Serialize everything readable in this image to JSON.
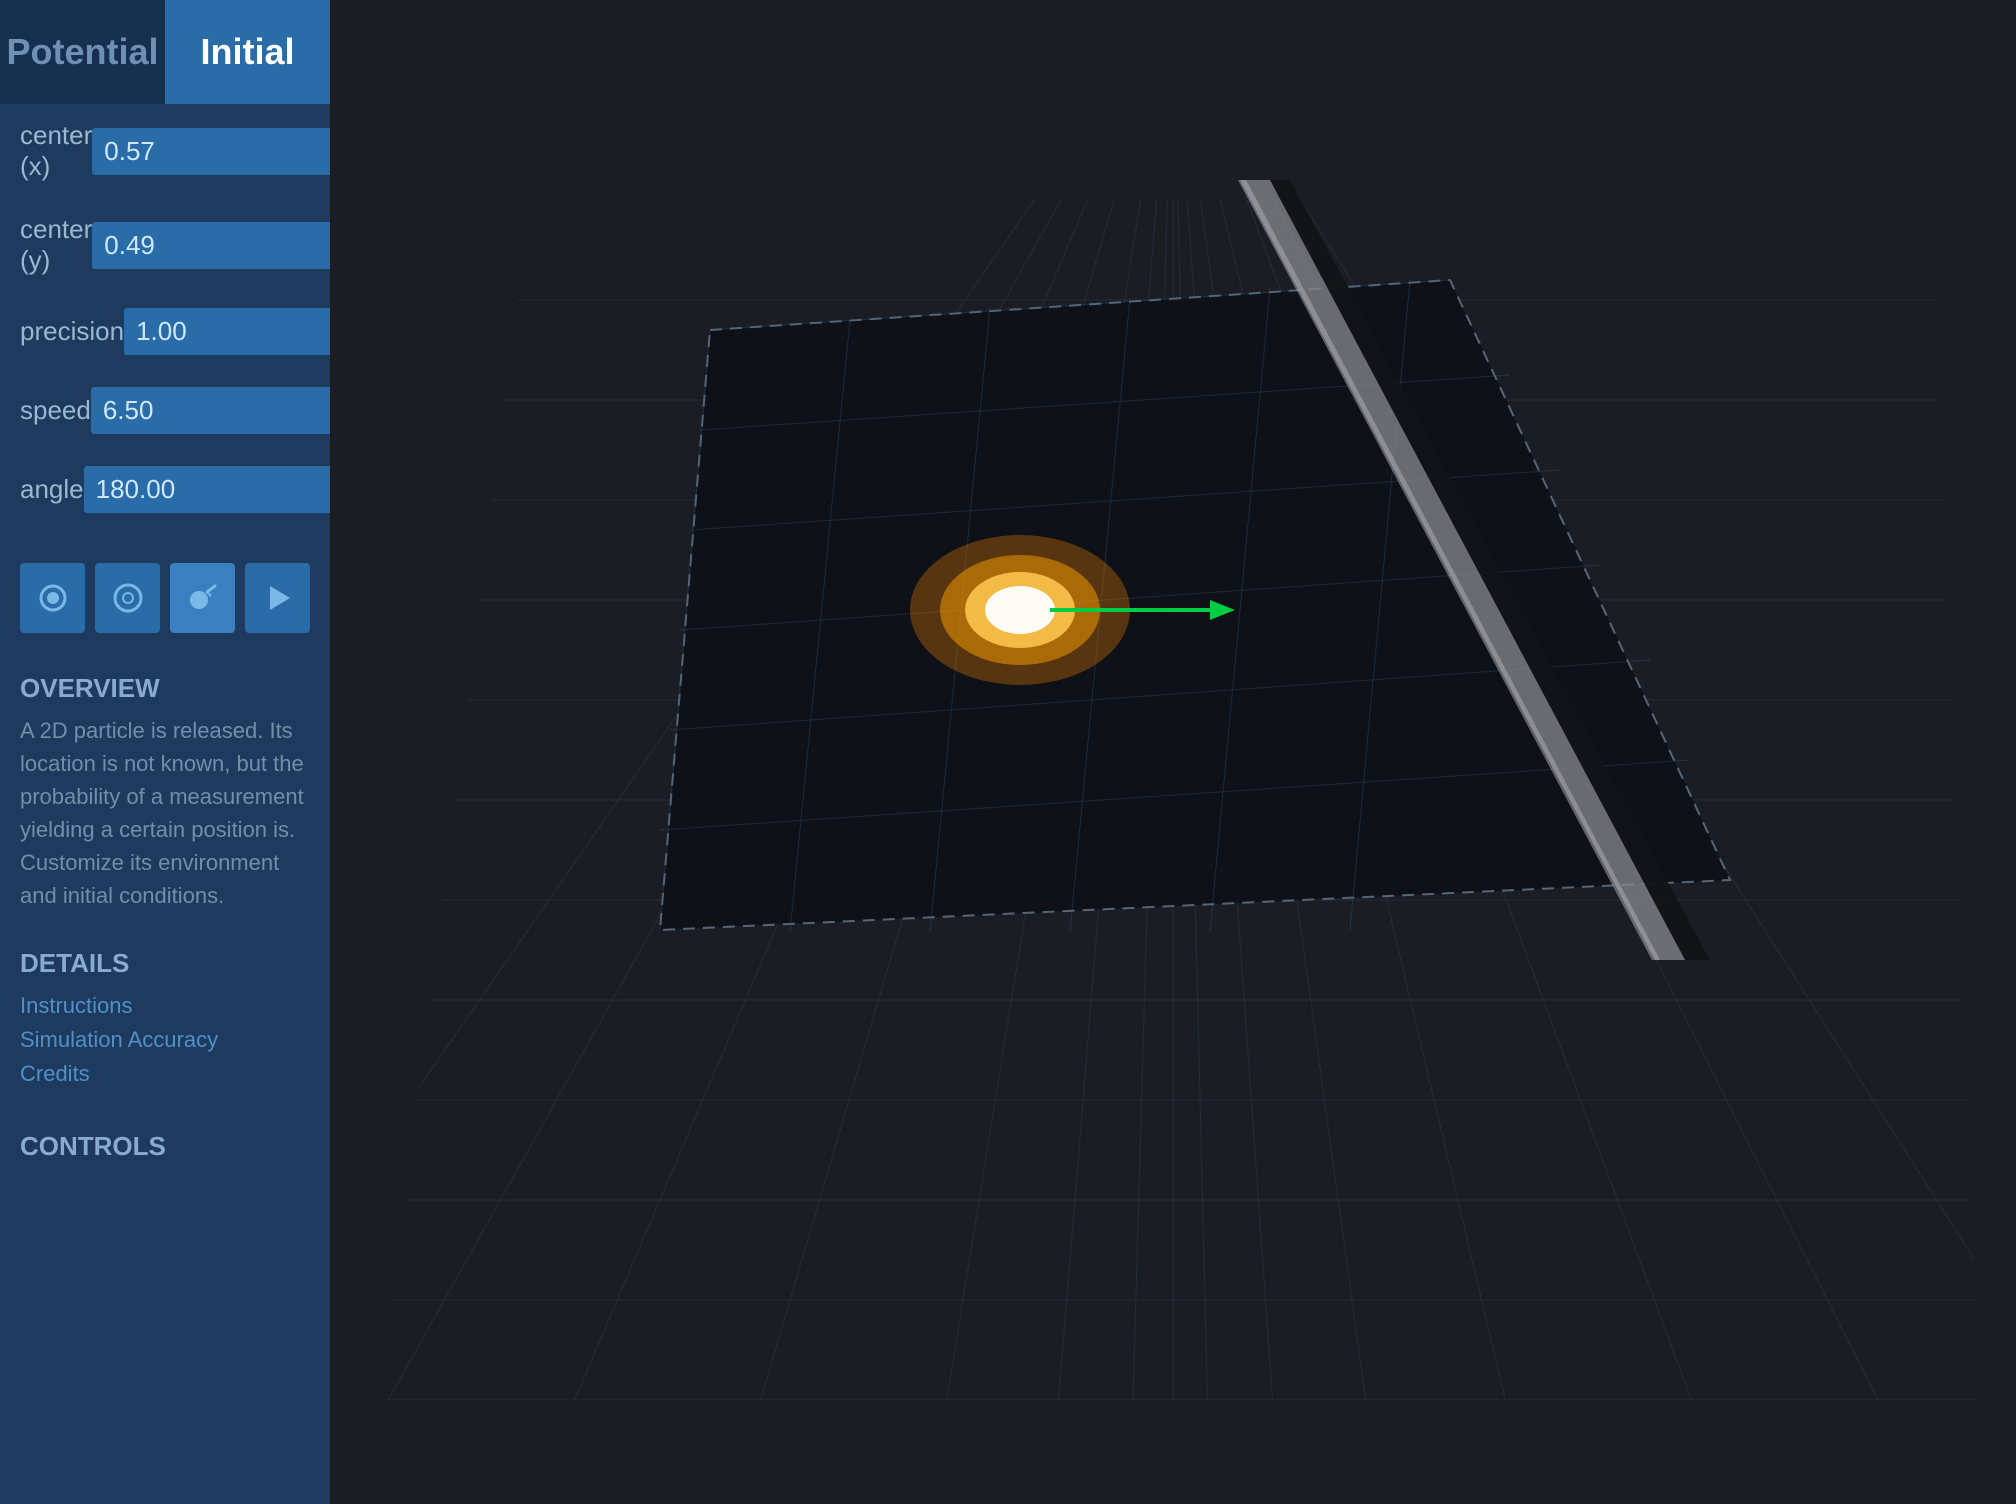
{
  "tabs": [
    {
      "label": "Potential",
      "id": "potential",
      "active": false
    },
    {
      "label": "Initial",
      "id": "initial",
      "active": true
    }
  ],
  "params": [
    {
      "label": "center (x)",
      "value": "0.57"
    },
    {
      "label": "center (y)",
      "value": "0.49"
    },
    {
      "label": "precision",
      "value": "1.00"
    },
    {
      "label": "speed",
      "value": "6.50"
    },
    {
      "label": "angle",
      "value": "180.00"
    }
  ],
  "controls": [
    {
      "icon": "●",
      "name": "add-particle",
      "active": false
    },
    {
      "icon": "◎",
      "name": "edit-particle",
      "active": false
    },
    {
      "icon": "✎",
      "name": "draw-tool",
      "active": true
    },
    {
      "icon": "▶",
      "name": "play-button",
      "active": false
    }
  ],
  "overview": {
    "title": "OVERVIEW",
    "text": "A 2D particle is released.  Its location is not known, but the probability of a measurement yielding a certain position is.\nCustomize its environment and initial conditions."
  },
  "details": {
    "title": "DETAILS",
    "links": [
      "Instructions",
      "Simulation Accuracy",
      "Credits"
    ]
  },
  "controls_section": {
    "title": "CONTROLS"
  },
  "scene": {
    "bg_color": "#1a1e24",
    "grid_color": "#2a3040"
  }
}
